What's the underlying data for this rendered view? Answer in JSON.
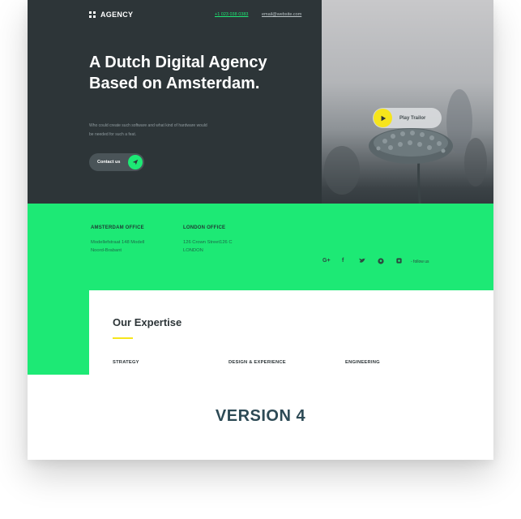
{
  "brand": {
    "name": "AGENCY"
  },
  "header": {
    "phone": "+1 023 038 0383",
    "email": "email@website.com"
  },
  "hero": {
    "headline": "A Dutch Digital Agency Based on Amsterdam.",
    "subtext": "Who could create such software and what kind of hardware would be needed for such a feat.",
    "cta_label": "Contact us"
  },
  "media": {
    "play_label": "Play Trailor"
  },
  "offices": [
    {
      "title": "AMSTERDAM OFFICE",
      "line1": "Modellefstraat 148 Modell",
      "line2": "Noord-Brabant"
    },
    {
      "title": "LONDON OFFICE",
      "line1": "126 Crown Street126 C",
      "line2": "LONDON"
    }
  ],
  "social": {
    "icons": [
      "google-plus-icon",
      "facebook-icon",
      "twitter-icon",
      "pinterest-icon",
      "instagram-icon"
    ],
    "follow_label": "- follow us"
  },
  "expertise": {
    "title": "Our Expertise",
    "tabs": [
      "STRATEGY",
      "DESIGN & EXPERIENCE",
      "ENGINEERING"
    ]
  },
  "footer": {
    "version_label": "VERSION 4"
  },
  "colors": {
    "dark": "#2d3538",
    "green": "#1de975",
    "yellow": "#f6e51c"
  }
}
